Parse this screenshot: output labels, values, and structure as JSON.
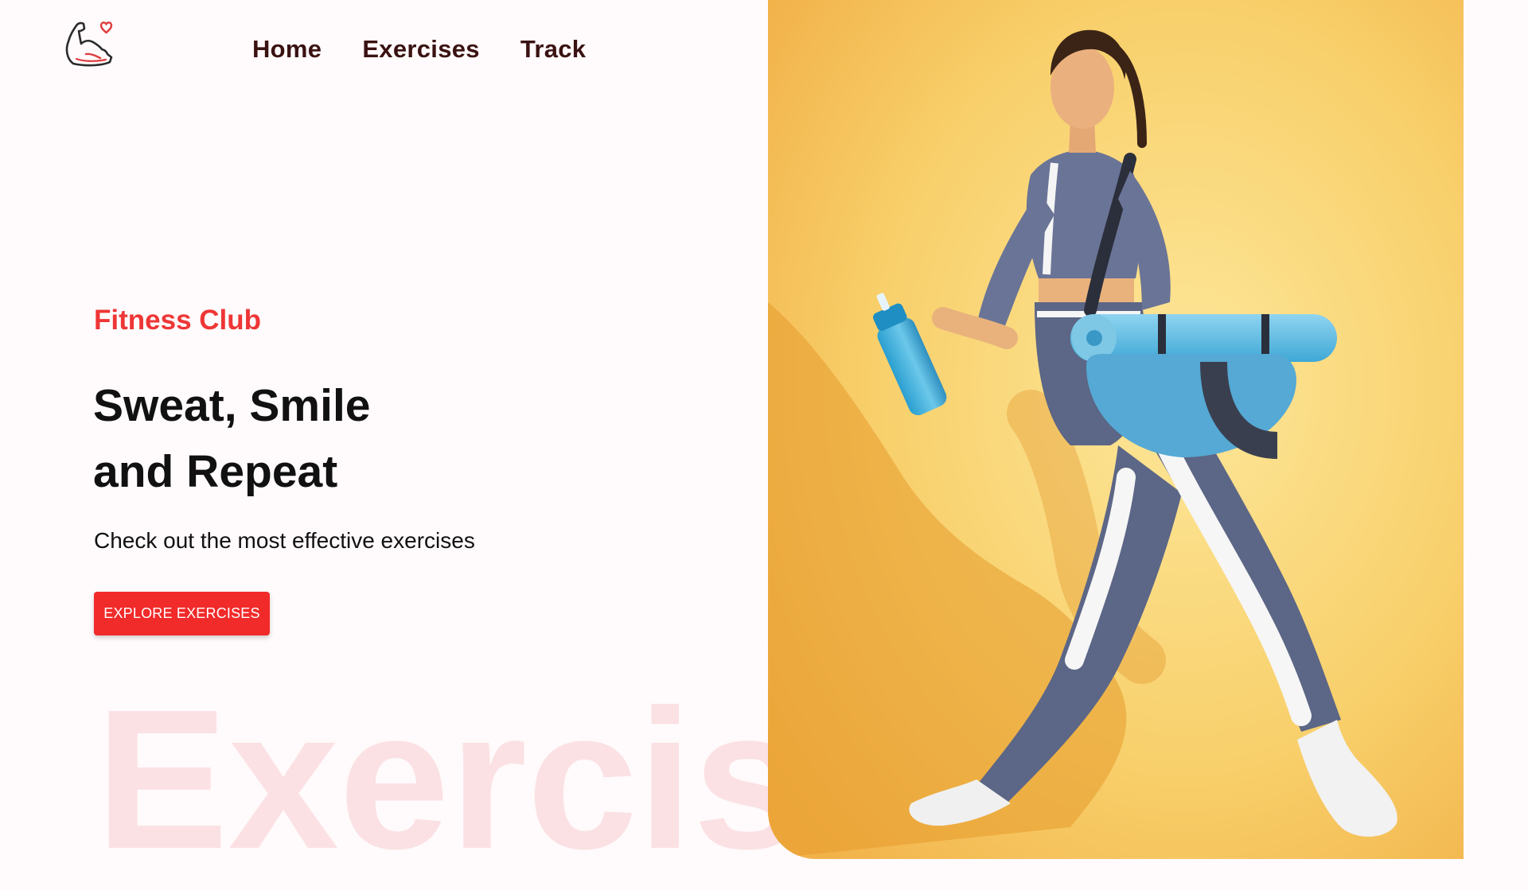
{
  "logo": {
    "icon": "flexed-arm-heart-icon"
  },
  "nav": {
    "items": [
      {
        "label": "Home"
      },
      {
        "label": "Exercises"
      },
      {
        "label": "Track"
      }
    ]
  },
  "hero": {
    "kicker": "Fitness Club",
    "headline_line1": "Sweat, Smile",
    "headline_line2": "and Repeat",
    "subtitle": "Check out the most effective exercises",
    "cta_label": "EXPLORE EXERCISES",
    "watermark": "Exercis"
  },
  "banner": {
    "image": "woman-walking-with-shaker-and-yoga-mat"
  },
  "colors": {
    "accent": "#f12a2a",
    "kicker": "#ee3636",
    "nav_text": "#3a1212",
    "background": "#fffafb",
    "banner_yellow": "#f6c35a"
  }
}
